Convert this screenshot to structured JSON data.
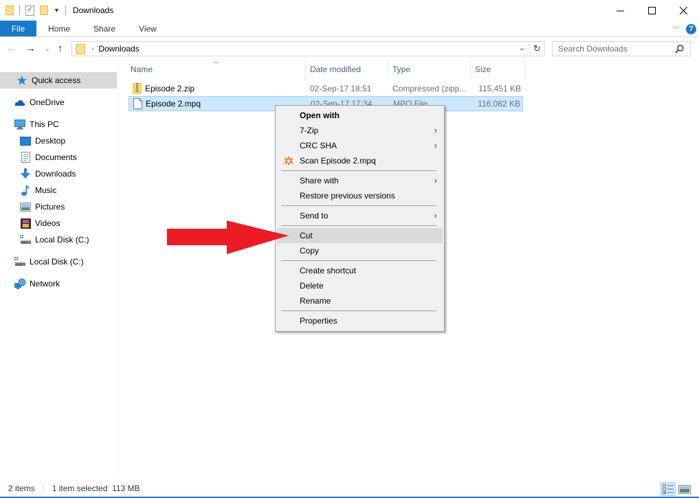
{
  "window": {
    "title": "Downloads",
    "controls": {
      "minimize": "minimize",
      "maximize": "maximize",
      "close": "close"
    }
  },
  "ribbon": {
    "tabs": [
      {
        "label": "File",
        "active": true
      },
      {
        "label": "Home"
      },
      {
        "label": "Share"
      },
      {
        "label": "View"
      }
    ],
    "help_label": "?"
  },
  "address": {
    "breadcrumb": [
      "Downloads"
    ],
    "search_placeholder": "Search Downloads"
  },
  "sidebar": {
    "items": [
      {
        "label": "Quick access",
        "icon": "star-icon",
        "selected": true
      },
      {
        "label": "OneDrive",
        "icon": "cloud-icon"
      },
      {
        "label": "This PC",
        "icon": "computer-icon"
      },
      {
        "label": "Desktop",
        "icon": "desktop-icon"
      },
      {
        "label": "Documents",
        "icon": "documents-icon"
      },
      {
        "label": "Downloads",
        "icon": "downloads-icon"
      },
      {
        "label": "Music",
        "icon": "music-icon"
      },
      {
        "label": "Pictures",
        "icon": "pictures-icon"
      },
      {
        "label": "Videos",
        "icon": "videos-icon"
      },
      {
        "label": "Local Disk (C:)",
        "icon": "drive-icon"
      },
      {
        "label": "Local Disk (C:)",
        "icon": "drive-icon"
      },
      {
        "label": "Network",
        "icon": "network-icon"
      }
    ]
  },
  "filelist": {
    "columns": [
      "Name",
      "Date modified",
      "Type",
      "Size"
    ],
    "rows": [
      {
        "name": "Episode 2.zip",
        "date": "02-Sep-17 18:51",
        "type": "Compressed (zipp...",
        "size": "115,451 KB",
        "icon": "zip-folder-icon",
        "selected": false
      },
      {
        "name": "Episode 2.mpq",
        "date": "02-Sep-17 17:34",
        "type": "MPQ File",
        "size": "116,082 KB",
        "icon": "file-icon",
        "selected": true
      }
    ]
  },
  "context_menu": {
    "items": [
      {
        "label": "Open with",
        "bold": true
      },
      {
        "label": "7-Zip",
        "submenu": true
      },
      {
        "label": "CRC SHA",
        "submenu": true
      },
      {
        "label": "Scan Episode 2.mpq",
        "icon": "avast-icon"
      },
      {
        "separator": true
      },
      {
        "label": "Share with",
        "submenu": true
      },
      {
        "label": "Restore previous versions"
      },
      {
        "separator": true
      },
      {
        "label": "Send to",
        "submenu": true
      },
      {
        "separator": true
      },
      {
        "label": "Cut",
        "hover": true
      },
      {
        "label": "Copy"
      },
      {
        "separator": true
      },
      {
        "label": "Create shortcut"
      },
      {
        "label": "Delete"
      },
      {
        "label": "Rename"
      },
      {
        "separator": true
      },
      {
        "label": "Properties"
      }
    ],
    "submenu_arrow": "›"
  },
  "annotation": {
    "arrow_color": "#ed1c24",
    "points_to": "Cut"
  },
  "statusbar": {
    "item_count": "2 items",
    "selection": "1 item selected  113 MB"
  },
  "colors": {
    "accent": "#1979ca",
    "selection_bg": "#cce8ff",
    "selection_border": "#99d1ff",
    "menu_bg": "#f0f0f0",
    "menu_hover": "#d9d9d9"
  }
}
